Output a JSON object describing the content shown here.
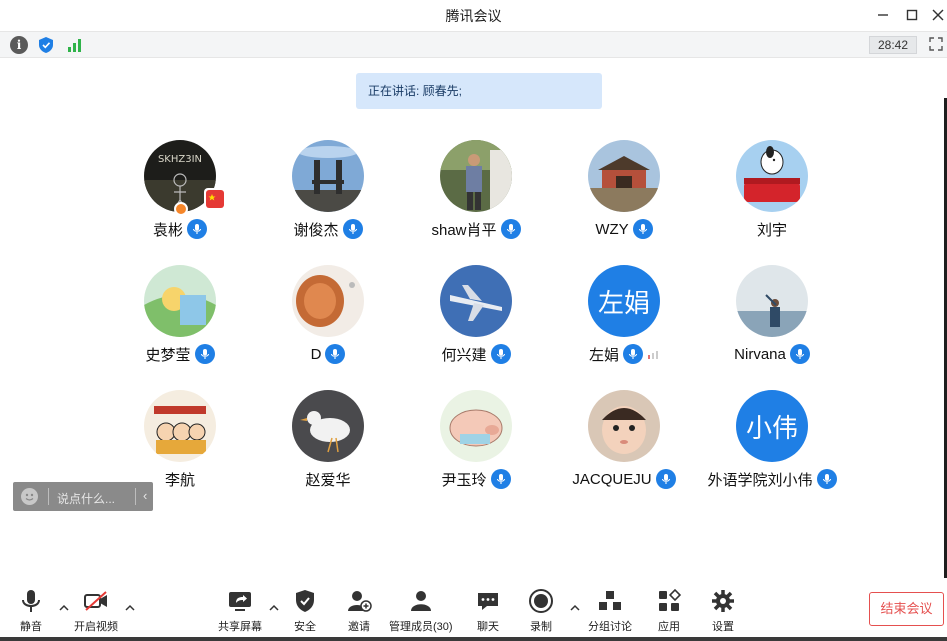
{
  "window": {
    "title": "腾讯会议"
  },
  "infobar": {
    "timer": "28:42"
  },
  "speaking": {
    "text": "正在讲话: 顾春先;"
  },
  "participants": [
    {
      "name": "袁彬"
    },
    {
      "name": "谢俊杰"
    },
    {
      "name": "shaw肖平"
    },
    {
      "name": "WZY"
    },
    {
      "name": "刘宇"
    },
    {
      "name": "史梦莹"
    },
    {
      "name": "D"
    },
    {
      "name": "何兴建"
    },
    {
      "name": "左娟",
      "avatar_text": "左娟"
    },
    {
      "name": "Nirvana"
    },
    {
      "name": "李航"
    },
    {
      "name": "赵爱华"
    },
    {
      "name": "尹玉玲"
    },
    {
      "name": "JACQUEJU"
    },
    {
      "name": "外语学院刘小伟",
      "avatar_text": "小伟"
    }
  ],
  "chat": {
    "placeholder": "说点什么..."
  },
  "toolbar": {
    "mute": "静音",
    "video": "开启视频",
    "share": "共享屏幕",
    "security": "安全",
    "invite": "邀请",
    "members": "管理成员(30)",
    "chat": "聊天",
    "record": "录制",
    "breakout": "分组讨论",
    "apps": "应用",
    "settings": "设置",
    "end": "结束会议"
  },
  "colors": {
    "accent": "#1f7fe5",
    "end": "#e5504f",
    "banner": "#d6e7fb"
  }
}
